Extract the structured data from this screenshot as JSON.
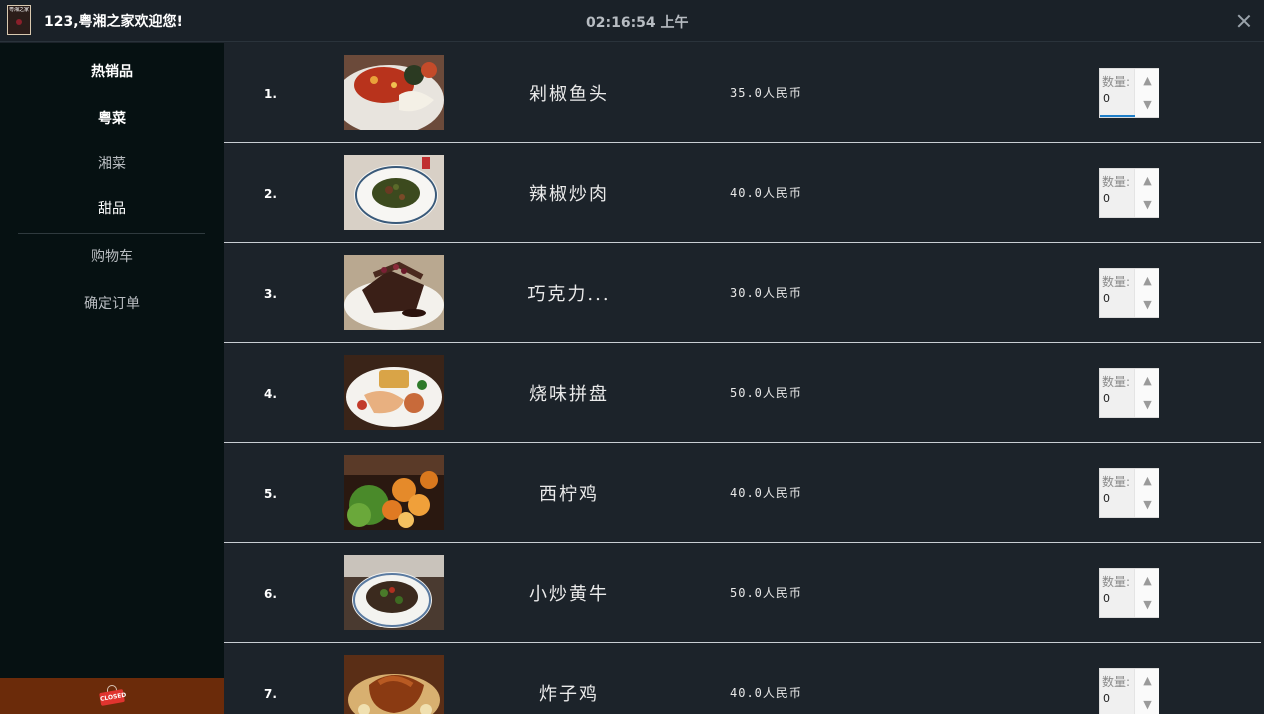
{
  "app": {
    "title": "123,粤湘之家欢迎您!",
    "logo_text": "粤湘之家",
    "clock": "02:16:54 上午",
    "close_icon": "close-icon"
  },
  "sidebar": {
    "items": [
      {
        "label": "热销品"
      },
      {
        "label": "粤菜"
      },
      {
        "label": "湘菜"
      },
      {
        "label": "甜品"
      },
      {
        "label": "购物车"
      },
      {
        "label": "确定订单"
      }
    ],
    "footer_icon": "closed-sign-icon",
    "footer_icon_text": "CLOSED",
    "footer_color": "#6b2b0a"
  },
  "quantity_label": "数量:",
  "spinner_up": "▲",
  "spinner_down": "▼",
  "dishes": [
    {
      "index": "1.",
      "name": "剁椒鱼头",
      "price": "35.0人民币",
      "qty": "0"
    },
    {
      "index": "2.",
      "name": "辣椒炒肉",
      "price": "40.0人民币",
      "qty": "0"
    },
    {
      "index": "3.",
      "name": "巧克力...",
      "price": "30.0人民币",
      "qty": "0"
    },
    {
      "index": "4.",
      "name": "烧味拼盘",
      "price": "50.0人民币",
      "qty": "0"
    },
    {
      "index": "5.",
      "name": "西柠鸡",
      "price": "40.0人民币",
      "qty": "0"
    },
    {
      "index": "6.",
      "name": "小炒黄牛",
      "price": "50.0人民币",
      "qty": "0"
    },
    {
      "index": "7.",
      "name": "炸子鸡",
      "price": "40.0人民币",
      "qty": "0"
    }
  ],
  "colors": {
    "background": "#1c232a",
    "sidebar": "#061112",
    "accent": "#1e7ec8"
  }
}
